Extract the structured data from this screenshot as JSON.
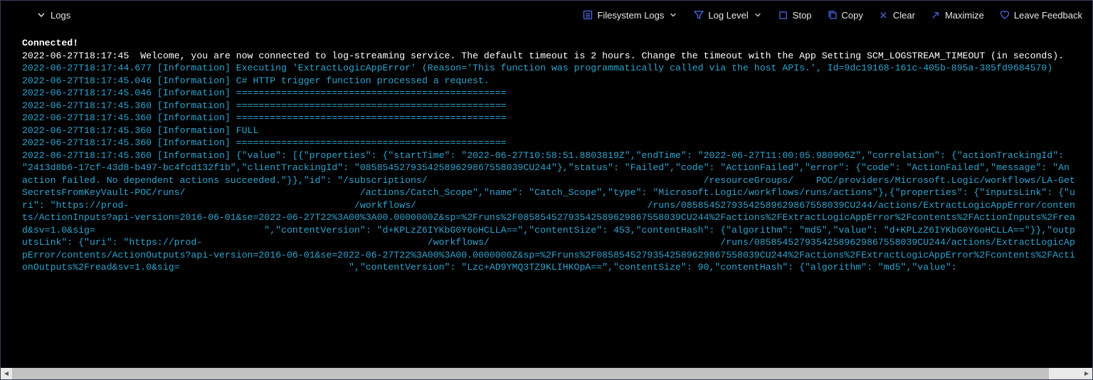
{
  "header": {
    "title": "Logs"
  },
  "toolbar": {
    "filesystem_logs": "Filesystem Logs",
    "log_level": "Log Level",
    "stop": "Stop",
    "copy": "Copy",
    "clear": "Clear",
    "maximize": "Maximize",
    "leave_feedback": "Leave Feedback"
  },
  "log_lines": [
    {
      "cls": "l-white",
      "text": "Connected!"
    },
    {
      "cls": "l-plain",
      "text": "2022-06-27T18:17:45  Welcome, you are now connected to log-streaming service. The default timeout is 2 hours. Change the timeout with the App Setting SCM_LOGSTREAM_TIMEOUT (in seconds)."
    },
    {
      "cls": "l-info",
      "text": "2022-06-27T18:17:44.677 [Information] Executing 'ExtractLogicAppError' (Reason='This function was programmatically called via the host APIs.', Id=9dc19168-161c-405b-895a-385fd9684570)"
    },
    {
      "cls": "l-info",
      "text": "2022-06-27T18:17:45.046 [Information] C# HTTP trigger function processed a request."
    },
    {
      "cls": "l-info",
      "text": "2022-06-27T18:17:45.046 [Information] ================================================"
    },
    {
      "cls": "l-info",
      "text": "2022-06-27T18:17:45.360 [Information] ================================================"
    },
    {
      "cls": "l-info",
      "text": "2022-06-27T18:17:45.360 [Information] ================================================"
    },
    {
      "cls": "l-info",
      "text": "2022-06-27T18:17:45.360 [Information] FULL"
    },
    {
      "cls": "l-info",
      "text": "2022-06-27T18:17:45.360 [Information] ================================================"
    },
    {
      "cls": "l-info",
      "text": "2022-06-27T18:17:45.360 [Information] {\"value\": [{\"properties\": {\"startTime\": \"2022-06-27T10:58:51.8803819Z\",\"endTime\": \"2022-06-27T11:00:05.980906Z\",\"correlation\": {\"actionTrackingId\": \"2413d8b6-17cf-43d8-b497-bc4fcd132f1b\",\"clientTrackingId\": \"08585452793542589629867558039CU244\"},\"status\": \"Failed\",\"code\": \"ActionFailed\",\"error\": {\"code\": \"ActionFailed\",\"message\": \"An action failed. No dependent actions succeeded.\"}},\"id\": \"/subscriptions/                                                 /resourceGroups/    POC/providers/Microsoft.Logic/workflows/LA-GetSecretsFromKeyVault-POC/runs/                               /actions/Catch_Scope\",\"name\": \"Catch_Scope\",\"type\": \"Microsoft.Logic/workflows/runs/actions\"},{\"properties\": {\"inputsLink\": {\"uri\": \"https://prod-                                        /workflows/                                         /runs/08585452793542589629867558039CU244/actions/ExtractLogicAppError/contents/ActionInputs?api-version=2016-06-01&se=2022-06-27T22%3A00%3A00.0000000Z&sp=%2Fruns%2F08585452793542589629867558039CU244%2Factions%2FExtractLogicAppError%2Fcontents%2FActionInputs%2Fread&sv=1.0&sig=                              \",\"contentVersion\": \"d+KPLzZ6IYKbG0Y6oHCLLA==\",\"contentSize\": 453,\"contentHash\": {\"algorithm\": \"md5\",\"value\": \"d+KPLzZ6IYKbG0Y6oHCLLA==\"}},\"outputsLink\": {\"uri\": \"https://prod-                                        /workflows/                                         /runs/08585452793542589629867558039CU244/actions/ExtractLogicAppError/contents/ActionOutputs?api-version=2016-06-01&se=2022-06-27T22%3A00%3A00.0000000Z&sp=%2Fruns%2F08585452793542589629867558039CU244%2Factions%2FExtractLogicAppError%2Fcontents%2FActionOutputs%2Fread&sv=1.0&sig=                              \",\"contentVersion\": \"Lzc+AD9YMQ3TZ9KLIHKOpA==\",\"contentSize\": 90,\"contentHash\": {\"algorithm\": \"md5\",\"value\":"
    }
  ]
}
